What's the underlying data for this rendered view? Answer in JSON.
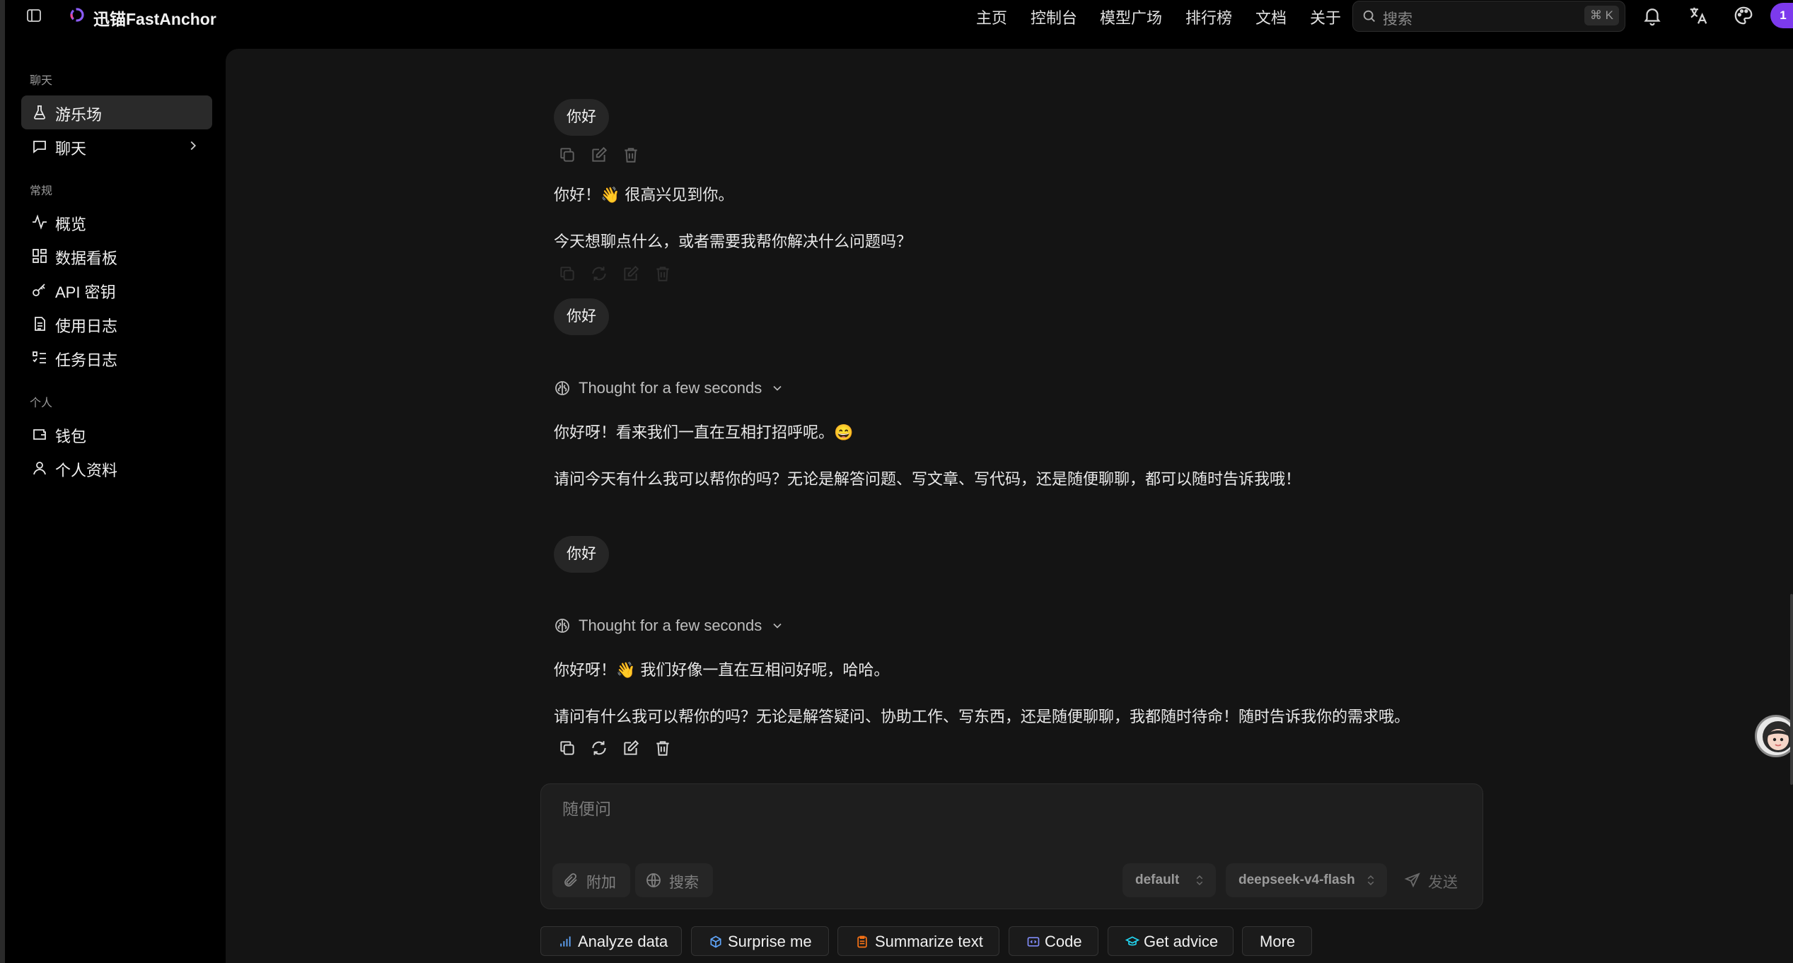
{
  "header": {
    "brand": "迅锚FastAnchor",
    "nav": [
      "主页",
      "控制台",
      "模型广场",
      "排行榜",
      "文档",
      "关于"
    ],
    "search_placeholder": "搜索",
    "search_shortcut": "⌘ K",
    "notification_count": "1"
  },
  "sidebar": {
    "sections": [
      {
        "title": "聊天",
        "items": [
          {
            "label": "游乐场",
            "icon": "flask-icon",
            "active": true
          },
          {
            "label": "聊天",
            "icon": "chat-icon",
            "expandable": true
          }
        ]
      },
      {
        "title": "常规",
        "items": [
          {
            "label": "概览",
            "icon": "activity-icon"
          },
          {
            "label": "数据看板",
            "icon": "dashboard-icon"
          },
          {
            "label": "API 密钥",
            "icon": "key-icon"
          },
          {
            "label": "使用日志",
            "icon": "file-icon"
          },
          {
            "label": "任务日志",
            "icon": "task-list-icon"
          }
        ]
      },
      {
        "title": "个人",
        "items": [
          {
            "label": "钱包",
            "icon": "wallet-icon"
          },
          {
            "label": "个人资料",
            "icon": "user-icon"
          }
        ]
      }
    ]
  },
  "conversation": [
    {
      "role": "user",
      "text": "你好"
    },
    {
      "role": "assistant",
      "lines": [
        "你好！👋 很高兴见到你。",
        "今天想聊点什么，或者需要我帮你解决什么问题吗？"
      ]
    },
    {
      "role": "user",
      "text": "你好"
    },
    {
      "role": "assistant",
      "thought": "Thought for a few seconds",
      "lines": [
        "你好呀！看来我们一直在互相打招呼呢。😄",
        "请问今天有什么我可以帮你的吗？无论是解答问题、写文章、写代码，还是随便聊聊，都可以随时告诉我哦！"
      ]
    },
    {
      "role": "user",
      "text": "你好"
    },
    {
      "role": "assistant",
      "thought": "Thought for a few seconds",
      "lines": [
        "你好呀！👋 我们好像一直在互相问好呢，哈哈。",
        "请问有什么我可以帮你的吗？无论是解答疑问、协助工作、写东西，还是随便聊聊，我都随时待命！随时告诉我你的需求哦。"
      ]
    }
  ],
  "composer": {
    "placeholder": "随便问",
    "attach_label": "附加",
    "search_label": "搜索",
    "group_value": "default",
    "model_value": "deepseek-v4-flash",
    "send_label": "发送"
  },
  "suggestions": [
    "Analyze data",
    "Surprise me",
    "Summarize text",
    "Code",
    "Get advice",
    "More"
  ],
  "colors": {
    "accent_badge": "#7c3aed",
    "panel_bg": "#141414",
    "page_bg": "#000000"
  }
}
